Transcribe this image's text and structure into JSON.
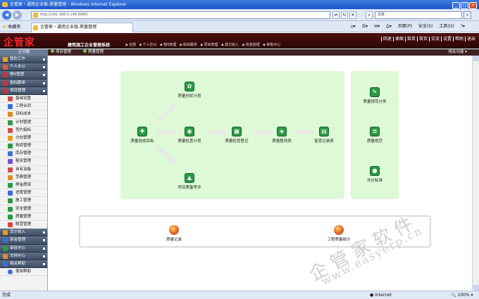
{
  "browser": {
    "window_title": "企管家・通用企业版-质量管理 - Windows Internet Explorer",
    "url": "http://192.168.0.146:6060/",
    "search_placeholder": "百度",
    "favorites_label": "收藏夹",
    "tab_title": "企管家・通用企业版-质量管理",
    "tools": [
      "页面(P)",
      "安全(S)",
      "工具(O)"
    ],
    "status_left": "完成",
    "status_zone": "Internet",
    "zoom": "100%"
  },
  "header": {
    "logo_text": "企管家",
    "system_name": "建筑施工企业管理系统",
    "top_links": [
      "回退",
      "桌面",
      "菜单",
      "首页",
      "交流",
      "设置",
      "帮助",
      "退出"
    ],
    "main_nav": [
      "▪ 全部",
      "▪ 个人办公",
      "▪ 物S管理",
      "▪ 投标跟单",
      "▪ 项目管理",
      "▪ 其它收入",
      "▪ 资金管理",
      "▪ 审批中心"
    ]
  },
  "crumbs": {
    "sidebar_title": "主功能",
    "crumb1": "项目管理",
    "crumb2": "质量管理",
    "related": "相关功能"
  },
  "sidebar": {
    "groups_top": [
      {
        "label": "我的工作",
        "color": "#e0a020"
      },
      {
        "label": "个人办公",
        "color": "#e06030"
      },
      {
        "label": "物S管理",
        "color": "#cc3333"
      },
      {
        "label": "投标跟单",
        "color": "#cc3333"
      },
      {
        "label": "项目管理",
        "color": "#cc3333"
      }
    ],
    "items": [
      {
        "label": "基础设置",
        "color": "#d94848"
      },
      {
        "label": "工程合同",
        "color": "#3a6fd8"
      },
      {
        "label": "目标成本",
        "color": "#e08a2a"
      },
      {
        "label": "计划管理",
        "color": "#2d9a45"
      },
      {
        "label": "签约指标",
        "color": "#d94848"
      },
      {
        "label": "分包管理",
        "color": "#e0a020"
      },
      {
        "label": "物资管理",
        "color": "#2d9a45"
      },
      {
        "label": "库存管理",
        "color": "#3a6fd8"
      },
      {
        "label": "租赁管理",
        "color": "#7b4fc9"
      },
      {
        "label": "自有设备",
        "color": "#d94848"
      },
      {
        "label": "劳務管理",
        "color": "#e08a2a"
      },
      {
        "label": "押金质保",
        "color": "#2d9a45"
      },
      {
        "label": "进度管理",
        "color": "#3a6fd8"
      },
      {
        "label": "施工管理",
        "color": "#2d9a45"
      },
      {
        "label": "安全管理",
        "color": "#2d9a45"
      },
      {
        "label": "质量管理",
        "color": "#2d9a45"
      },
      {
        "label": "联营管理",
        "color": "#d94848"
      }
    ],
    "groups_bottom": [
      {
        "label": "其它收入",
        "color": "#e0a020"
      },
      {
        "label": "资金管理",
        "color": "#3a6fd8"
      },
      {
        "label": "审批中心",
        "color": "#2d9a45"
      },
      {
        "label": "文档中心",
        "color": "#e08a2a"
      },
      {
        "label": "相关帮助",
        "color": "#3a6fd8"
      }
    ],
    "help_item": "使用帮助"
  },
  "flow": {
    "nodes": [
      {
        "label": "质量创优计划",
        "icon": "✿"
      },
      {
        "label": "质量验收目标",
        "icon": "✚"
      },
      {
        "label": "质量检查计划",
        "icon": "◉"
      },
      {
        "label": "质量检查登记",
        "icon": "▦"
      },
      {
        "label": "质量整改表",
        "icon": "◈"
      },
      {
        "label": "复查记录表",
        "icon": "▤"
      },
      {
        "label": "项目质量考评",
        "icon": "▲"
      }
    ]
  },
  "standards": {
    "items": [
      {
        "label": "质量规范分类",
        "icon": "✎"
      },
      {
        "label": "质量规范",
        "icon": "≣"
      },
      {
        "label": "评分标准",
        "icon": "●"
      }
    ]
  },
  "records": {
    "items": [
      {
        "label": "质量记录"
      },
      {
        "label": "工程质量统计"
      }
    ]
  },
  "watermark": {
    "text_cn": "企管家软件",
    "text_url": "www.easyerp.cn"
  }
}
